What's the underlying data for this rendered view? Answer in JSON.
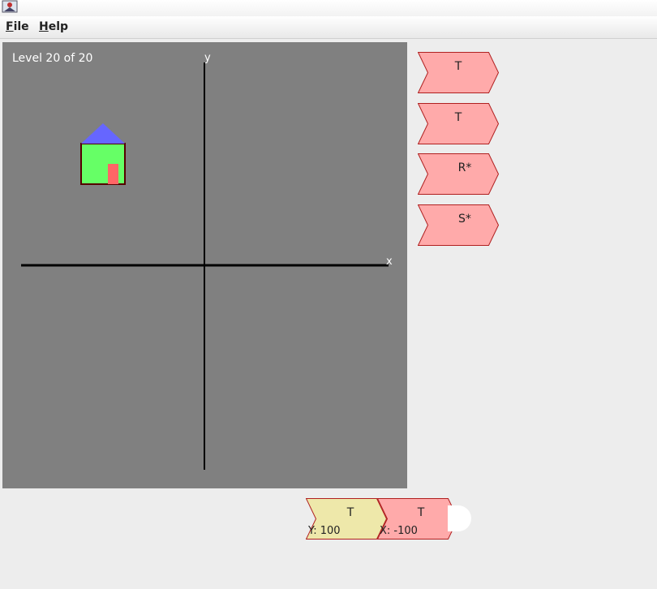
{
  "menu": {
    "file": {
      "mnemonic": "F",
      "rest": "ile"
    },
    "help": {
      "mnemonic": "H",
      "rest": "elp"
    }
  },
  "canvas": {
    "level_label": "Level 20 of 20",
    "x_axis_label": "x",
    "y_axis_label": "y"
  },
  "palette": [
    {
      "label": "T"
    },
    {
      "label": "T"
    },
    {
      "label": "R*"
    },
    {
      "label": "S*"
    }
  ],
  "program": [
    {
      "label": "T",
      "param": "Y: 100"
    },
    {
      "label": "T",
      "param": "X: -100"
    }
  ],
  "colors": {
    "canvas_bg": "#808080",
    "palette_block": "#ffaaaa",
    "palette_border": "#b02020",
    "program_block_1": "#eee8aa",
    "house_wall": "#66ff66",
    "house_roof": "#6666ff",
    "house_door": "#ff6666"
  }
}
